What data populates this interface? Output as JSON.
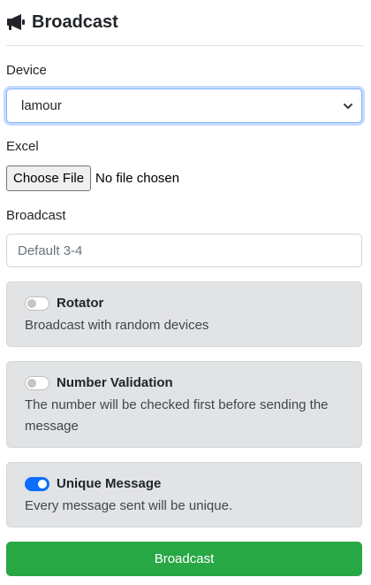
{
  "header": {
    "title": "Broadcast",
    "icon": "megaphone-icon"
  },
  "device": {
    "label": "Device",
    "selected": "lamour"
  },
  "excel": {
    "label": "Excel",
    "button": "Choose File",
    "status": "No file chosen"
  },
  "broadcast": {
    "label": "Broadcast",
    "placeholder": "Default 3-4"
  },
  "options": [
    {
      "title": "Rotator",
      "description": "Broadcast with random devices",
      "enabled": false
    },
    {
      "title": "Number Validation",
      "description": "The number will be checked first before sending the message",
      "enabled": false
    },
    {
      "title": "Unique Message",
      "description": "Every message sent will be unique.",
      "enabled": true
    }
  ],
  "submit": {
    "label": "Broadcast"
  },
  "colors": {
    "accent": "#0d6efd",
    "submit": "#28a745",
    "card_bg": "#e2e3e5"
  }
}
